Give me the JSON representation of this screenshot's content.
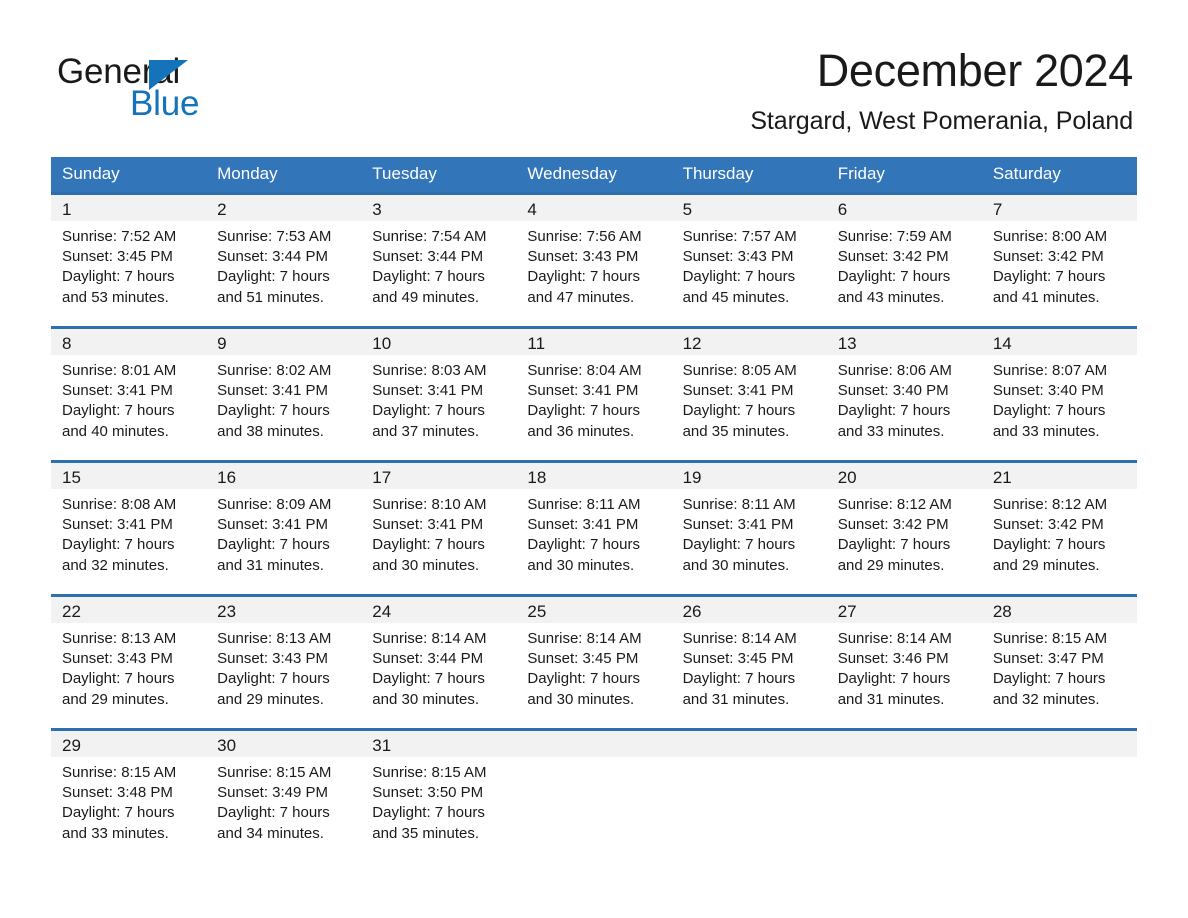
{
  "brand": {
    "name_part1": "General",
    "name_part2": "Blue"
  },
  "header": {
    "month_title": "December 2024",
    "location": "Stargard, West Pomerania, Poland"
  },
  "colors": {
    "header_blue": "#3275b9",
    "row_border_blue": "#2e6fb0",
    "daynum_band": "#f2f2f2",
    "brand_blue": "#1573b9",
    "text": "#1a1a1a"
  },
  "weekday_headers": [
    "Sunday",
    "Monday",
    "Tuesday",
    "Wednesday",
    "Thursday",
    "Friday",
    "Saturday"
  ],
  "labels": {
    "sunrise_prefix": "Sunrise:",
    "sunset_prefix": "Sunset:",
    "daylight_prefix": "Daylight:"
  },
  "weeks": [
    [
      {
        "day": "1",
        "sunrise": "Sunrise: 7:52 AM",
        "sunset": "Sunset: 3:45 PM",
        "daylight_line1": "Daylight: 7 hours",
        "daylight_line2": "and 53 minutes."
      },
      {
        "day": "2",
        "sunrise": "Sunrise: 7:53 AM",
        "sunset": "Sunset: 3:44 PM",
        "daylight_line1": "Daylight: 7 hours",
        "daylight_line2": "and 51 minutes."
      },
      {
        "day": "3",
        "sunrise": "Sunrise: 7:54 AM",
        "sunset": "Sunset: 3:44 PM",
        "daylight_line1": "Daylight: 7 hours",
        "daylight_line2": "and 49 minutes."
      },
      {
        "day": "4",
        "sunrise": "Sunrise: 7:56 AM",
        "sunset": "Sunset: 3:43 PM",
        "daylight_line1": "Daylight: 7 hours",
        "daylight_line2": "and 47 minutes."
      },
      {
        "day": "5",
        "sunrise": "Sunrise: 7:57 AM",
        "sunset": "Sunset: 3:43 PM",
        "daylight_line1": "Daylight: 7 hours",
        "daylight_line2": "and 45 minutes."
      },
      {
        "day": "6",
        "sunrise": "Sunrise: 7:59 AM",
        "sunset": "Sunset: 3:42 PM",
        "daylight_line1": "Daylight: 7 hours",
        "daylight_line2": "and 43 minutes."
      },
      {
        "day": "7",
        "sunrise": "Sunrise: 8:00 AM",
        "sunset": "Sunset: 3:42 PM",
        "daylight_line1": "Daylight: 7 hours",
        "daylight_line2": "and 41 minutes."
      }
    ],
    [
      {
        "day": "8",
        "sunrise": "Sunrise: 8:01 AM",
        "sunset": "Sunset: 3:41 PM",
        "daylight_line1": "Daylight: 7 hours",
        "daylight_line2": "and 40 minutes."
      },
      {
        "day": "9",
        "sunrise": "Sunrise: 8:02 AM",
        "sunset": "Sunset: 3:41 PM",
        "daylight_line1": "Daylight: 7 hours",
        "daylight_line2": "and 38 minutes."
      },
      {
        "day": "10",
        "sunrise": "Sunrise: 8:03 AM",
        "sunset": "Sunset: 3:41 PM",
        "daylight_line1": "Daylight: 7 hours",
        "daylight_line2": "and 37 minutes."
      },
      {
        "day": "11",
        "sunrise": "Sunrise: 8:04 AM",
        "sunset": "Sunset: 3:41 PM",
        "daylight_line1": "Daylight: 7 hours",
        "daylight_line2": "and 36 minutes."
      },
      {
        "day": "12",
        "sunrise": "Sunrise: 8:05 AM",
        "sunset": "Sunset: 3:41 PM",
        "daylight_line1": "Daylight: 7 hours",
        "daylight_line2": "and 35 minutes."
      },
      {
        "day": "13",
        "sunrise": "Sunrise: 8:06 AM",
        "sunset": "Sunset: 3:40 PM",
        "daylight_line1": "Daylight: 7 hours",
        "daylight_line2": "and 33 minutes."
      },
      {
        "day": "14",
        "sunrise": "Sunrise: 8:07 AM",
        "sunset": "Sunset: 3:40 PM",
        "daylight_line1": "Daylight: 7 hours",
        "daylight_line2": "and 33 minutes."
      }
    ],
    [
      {
        "day": "15",
        "sunrise": "Sunrise: 8:08 AM",
        "sunset": "Sunset: 3:41 PM",
        "daylight_line1": "Daylight: 7 hours",
        "daylight_line2": "and 32 minutes."
      },
      {
        "day": "16",
        "sunrise": "Sunrise: 8:09 AM",
        "sunset": "Sunset: 3:41 PM",
        "daylight_line1": "Daylight: 7 hours",
        "daylight_line2": "and 31 minutes."
      },
      {
        "day": "17",
        "sunrise": "Sunrise: 8:10 AM",
        "sunset": "Sunset: 3:41 PM",
        "daylight_line1": "Daylight: 7 hours",
        "daylight_line2": "and 30 minutes."
      },
      {
        "day": "18",
        "sunrise": "Sunrise: 8:11 AM",
        "sunset": "Sunset: 3:41 PM",
        "daylight_line1": "Daylight: 7 hours",
        "daylight_line2": "and 30 minutes."
      },
      {
        "day": "19",
        "sunrise": "Sunrise: 8:11 AM",
        "sunset": "Sunset: 3:41 PM",
        "daylight_line1": "Daylight: 7 hours",
        "daylight_line2": "and 30 minutes."
      },
      {
        "day": "20",
        "sunrise": "Sunrise: 8:12 AM",
        "sunset": "Sunset: 3:42 PM",
        "daylight_line1": "Daylight: 7 hours",
        "daylight_line2": "and 29 minutes."
      },
      {
        "day": "21",
        "sunrise": "Sunrise: 8:12 AM",
        "sunset": "Sunset: 3:42 PM",
        "daylight_line1": "Daylight: 7 hours",
        "daylight_line2": "and 29 minutes."
      }
    ],
    [
      {
        "day": "22",
        "sunrise": "Sunrise: 8:13 AM",
        "sunset": "Sunset: 3:43 PM",
        "daylight_line1": "Daylight: 7 hours",
        "daylight_line2": "and 29 minutes."
      },
      {
        "day": "23",
        "sunrise": "Sunrise: 8:13 AM",
        "sunset": "Sunset: 3:43 PM",
        "daylight_line1": "Daylight: 7 hours",
        "daylight_line2": "and 29 minutes."
      },
      {
        "day": "24",
        "sunrise": "Sunrise: 8:14 AM",
        "sunset": "Sunset: 3:44 PM",
        "daylight_line1": "Daylight: 7 hours",
        "daylight_line2": "and 30 minutes."
      },
      {
        "day": "25",
        "sunrise": "Sunrise: 8:14 AM",
        "sunset": "Sunset: 3:45 PM",
        "daylight_line1": "Daylight: 7 hours",
        "daylight_line2": "and 30 minutes."
      },
      {
        "day": "26",
        "sunrise": "Sunrise: 8:14 AM",
        "sunset": "Sunset: 3:45 PM",
        "daylight_line1": "Daylight: 7 hours",
        "daylight_line2": "and 31 minutes."
      },
      {
        "day": "27",
        "sunrise": "Sunrise: 8:14 AM",
        "sunset": "Sunset: 3:46 PM",
        "daylight_line1": "Daylight: 7 hours",
        "daylight_line2": "and 31 minutes."
      },
      {
        "day": "28",
        "sunrise": "Sunrise: 8:15 AM",
        "sunset": "Sunset: 3:47 PM",
        "daylight_line1": "Daylight: 7 hours",
        "daylight_line2": "and 32 minutes."
      }
    ],
    [
      {
        "day": "29",
        "sunrise": "Sunrise: 8:15 AM",
        "sunset": "Sunset: 3:48 PM",
        "daylight_line1": "Daylight: 7 hours",
        "daylight_line2": "and 33 minutes."
      },
      {
        "day": "30",
        "sunrise": "Sunrise: 8:15 AM",
        "sunset": "Sunset: 3:49 PM",
        "daylight_line1": "Daylight: 7 hours",
        "daylight_line2": "and 34 minutes."
      },
      {
        "day": "31",
        "sunrise": "Sunrise: 8:15 AM",
        "sunset": "Sunset: 3:50 PM",
        "daylight_line1": "Daylight: 7 hours",
        "daylight_line2": "and 35 minutes."
      },
      {
        "day": "",
        "sunrise": "",
        "sunset": "",
        "daylight_line1": "",
        "daylight_line2": ""
      },
      {
        "day": "",
        "sunrise": "",
        "sunset": "",
        "daylight_line1": "",
        "daylight_line2": ""
      },
      {
        "day": "",
        "sunrise": "",
        "sunset": "",
        "daylight_line1": "",
        "daylight_line2": ""
      },
      {
        "day": "",
        "sunrise": "",
        "sunset": "",
        "daylight_line1": "",
        "daylight_line2": ""
      }
    ]
  ]
}
